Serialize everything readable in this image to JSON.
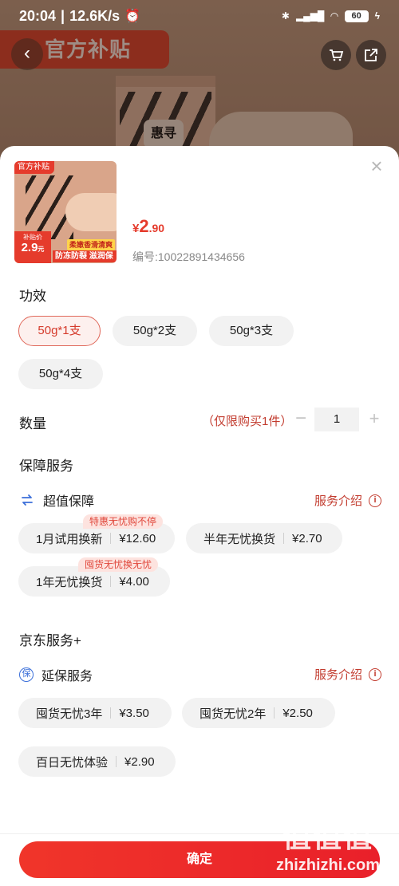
{
  "status_bar": {
    "time": "20:04",
    "speed": "12.6K/s",
    "battery": "60"
  },
  "background": {
    "banner": "官方补贴",
    "product_logo": "惠寻"
  },
  "sheet": {
    "thumbnail": {
      "badge": "官方补贴",
      "price_label": "补贴价",
      "price": "2.9",
      "price_unit": "元",
      "tag_yellow": "柔嫩香滑清爽",
      "tag_red": "防冻防裂 滋润保湿"
    },
    "price": {
      "currency": "¥",
      "integer": "2",
      "decimal": ".90"
    },
    "sku": "编号:10022891434656",
    "efficacy": {
      "title": "功效",
      "options": [
        "50g*1支",
        "50g*2支",
        "50g*3支",
        "50g*4支"
      ],
      "selected_index": 0
    },
    "quantity": {
      "title": "数量",
      "note": "（仅限购买1件）",
      "value": "1",
      "minus": "−",
      "plus": "+"
    },
    "guarantee": {
      "title": "保障服务",
      "group1": {
        "name": "超值保障",
        "link": "服务介绍",
        "items": [
          {
            "name": "1月试用换新",
            "price": "¥12.60",
            "tag": "特惠无忧购不停"
          },
          {
            "name": "半年无忧换货",
            "price": "¥2.70"
          },
          {
            "name": "1年无忧换货",
            "price": "¥4.00",
            "tag": "囤货无忧换无忧"
          }
        ]
      }
    },
    "jd_service": {
      "title": "京东服务+",
      "group": {
        "name": "延保服务",
        "icon_text": "保",
        "link": "服务介绍",
        "items": [
          {
            "name": "囤货无忧3年",
            "price": "¥3.50"
          },
          {
            "name": "囤货无忧2年",
            "price": "¥2.50"
          },
          {
            "name": "百日无忧体验",
            "price": "¥2.90"
          }
        ]
      }
    },
    "confirm": "确定"
  },
  "watermark": {
    "big": "值值值",
    "small": "zhizhizhi.com"
  },
  "colors": {
    "accent": "#e53b2c",
    "chip_bg": "#f2f2f2",
    "selected_border": "#e0685a"
  }
}
